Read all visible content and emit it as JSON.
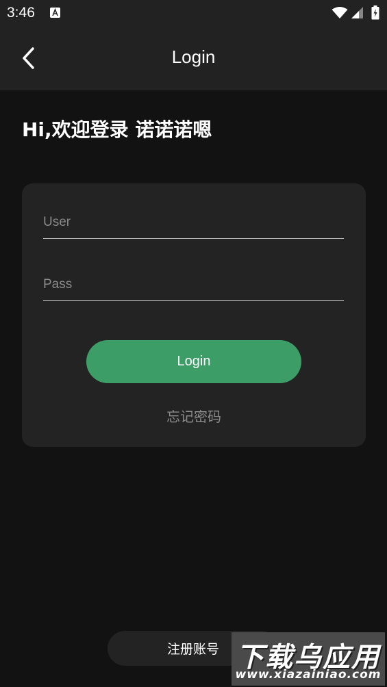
{
  "status_bar": {
    "time": "3:46",
    "icons": [
      "notification-a-icon",
      "wifi-icon",
      "signal-icon",
      "battery-icon"
    ]
  },
  "app_bar": {
    "title": "Login",
    "back_icon": "back-chevron-icon"
  },
  "greeting": "Hi,欢迎登录 诺诺诺嗯",
  "form": {
    "user_placeholder": "User",
    "user_value": "",
    "pass_placeholder": "Pass",
    "pass_value": "",
    "login_label": "Login",
    "forgot_label": "忘记密码"
  },
  "register_label": "注册账号",
  "watermark": {
    "title": "下载乌应用",
    "url": "www.xiazainiao.com"
  },
  "colors": {
    "background": "#121212",
    "app_bar": "#222222",
    "card": "#232323",
    "accent": "#3d9d66",
    "muted_text": "#8c8c8c"
  }
}
